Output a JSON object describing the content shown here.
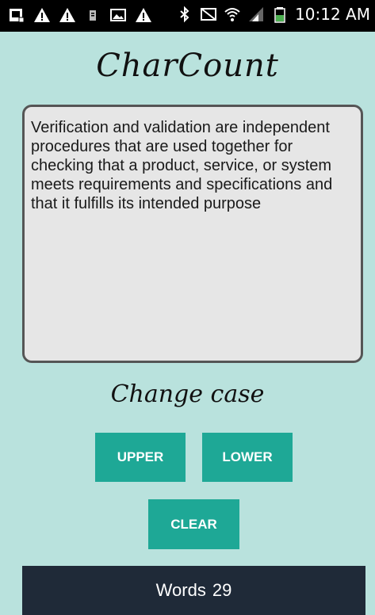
{
  "status_bar": {
    "time": "10:12 AM",
    "left_icons": [
      "gallery-icon",
      "warning-icon",
      "warning-icon",
      "storage-icon",
      "image-icon",
      "warning-icon"
    ],
    "right_icons": [
      "bluetooth-icon",
      "no-signal-icon",
      "wifi-icon",
      "signal-icon",
      "battery-icon"
    ]
  },
  "app": {
    "title": "CharCount"
  },
  "editor": {
    "text": "Verification and validation are independent procedures that are used together for checking that a product, service, or system meets requirements and specifications and that it fulfills its intended purpose"
  },
  "change_case": {
    "label": "Change case",
    "upper_label": "UPPER",
    "lower_label": "LOWER",
    "clear_label": "CLEAR"
  },
  "stats": {
    "words_label": "Words",
    "words_count": "29"
  },
  "colors": {
    "background": "#b9e2dd",
    "button": "#1ea896",
    "panel": "#1f2a38"
  }
}
